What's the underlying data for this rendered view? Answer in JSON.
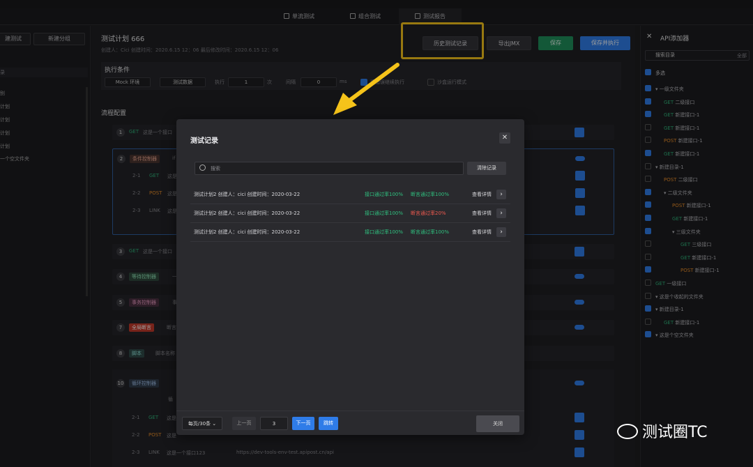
{
  "tabs": [
    {
      "label": "单流测试",
      "active": false
    },
    {
      "label": "组合测试",
      "active": false
    },
    {
      "label": "测试报告",
      "active": true
    }
  ],
  "left": {
    "btn1": "建测试",
    "btn2": "新建分组",
    "search_hint": "录",
    "items": [
      "别",
      "计划",
      "计划",
      "计划",
      "计划",
      "一个空文件夹"
    ]
  },
  "plan": {
    "title": "测试计划 666",
    "meta": "创建人：Cici    创建时间：2020.6.15    12：06        最后修改时间：2020.6.15    12：06",
    "history_button": "历史测试记录",
    "export_button": "导出JMX",
    "save_button": "保存",
    "save_run_button": "保存并执行"
  },
  "exec": {
    "title": "执行条件",
    "env": "Mock 环境",
    "test_data": "测试数据",
    "run_label": "执行",
    "run_value": "1",
    "run_unit": "次",
    "interval_label": "间隔",
    "interval_value": "0",
    "interval_unit": "ms",
    "continue_on_error": "遇错误继续执行",
    "sandbox": "沙盒运行模式"
  },
  "flow": {
    "title": "流程配置",
    "rows": [
      {
        "num": "1",
        "method": "GET",
        "text": "这是一个接口"
      },
      {
        "num": "2",
        "tag": "条件控制器",
        "text": "if"
      },
      {
        "num": "2-1",
        "method": "GET",
        "text": "这是"
      },
      {
        "num": "2-2",
        "method": "POST",
        "text": "这是"
      },
      {
        "num": "2-3",
        "method": "LINK",
        "text": "这是"
      },
      {
        "num": "3",
        "method": "GET",
        "text": "这是一个接口"
      },
      {
        "num": "4",
        "tag": "等待控制器",
        "text": "一"
      },
      {
        "num": "5",
        "tag": "事务控制器",
        "text": "事"
      },
      {
        "num": "7",
        "tag": "全局断言",
        "text": "断言"
      },
      {
        "num": "8",
        "tag": "脚本",
        "text": "脚本名称"
      },
      {
        "num": "10",
        "tag": "循环控制器",
        "text": "循"
      },
      {
        "num": "2-1",
        "method": "GET",
        "text": "这是"
      },
      {
        "num": "2-2",
        "method": "POST",
        "text": "这是"
      },
      {
        "num": "2-3",
        "method": "LINK",
        "text": "这是一个接口123",
        "url": "https://dev-tools-env-test.apipost.cn/api"
      }
    ]
  },
  "api_panel": {
    "title": "API添加器",
    "search_placeholder": "搜索目录",
    "filter": "全部",
    "multi": "多选",
    "tree": [
      {
        "text": "一级文件夹",
        "chk": true,
        "indent": 0
      },
      {
        "method": "GET",
        "text": "二级接口",
        "chk": true,
        "indent": 1
      },
      {
        "method": "GET",
        "text": "新建接口-1",
        "chk": true,
        "indent": 1
      },
      {
        "method": "GET",
        "text": "新建接口-1",
        "chk": false,
        "indent": 1
      },
      {
        "method": "POST",
        "text": "新建接口-1",
        "chk": false,
        "indent": 1
      },
      {
        "method": "GET",
        "text": "新建接口-1",
        "chk": true,
        "indent": 1
      },
      {
        "text": "新建目录-1",
        "chk": false,
        "indent": 0
      },
      {
        "method": "POST",
        "text": "二级接口",
        "chk": false,
        "indent": 1
      },
      {
        "text": "二级文件夹",
        "chk": true,
        "indent": 1
      },
      {
        "method": "POST",
        "text": "新建接口-1",
        "chk": true,
        "indent": 2
      },
      {
        "method": "GET",
        "text": "新建接口-1",
        "chk": true,
        "indent": 2
      },
      {
        "text": "三级文件夹",
        "chk": true,
        "indent": 2
      },
      {
        "method": "GET",
        "text": "三级接口",
        "chk": false,
        "indent": 3
      },
      {
        "method": "GET",
        "text": "新建接口-1",
        "chk": false,
        "indent": 3
      },
      {
        "method": "POST",
        "text": "新建接口-1",
        "chk": true,
        "indent": 3
      },
      {
        "method": "GET",
        "text": "一级接口",
        "chk": false,
        "indent": 0
      },
      {
        "text": "这是个收起的文件夹",
        "chk": false,
        "indent": 0
      },
      {
        "text": "新建目录-1",
        "chk": true,
        "indent": 0
      },
      {
        "method": "GET",
        "text": "新建接口-1",
        "chk": false,
        "indent": 1
      },
      {
        "text": "这是个空文件夹",
        "chk": true,
        "indent": 0
      }
    ]
  },
  "modal": {
    "title": "测试记录",
    "search_placeholder": "搜索",
    "clear": "清除记录",
    "records": [
      {
        "info": "测试计划2   创建人：cici   创建时间：2020-03-22",
        "api": "接口通过率100%",
        "assert": "断言通过率100%",
        "assert_ok": true,
        "detail": "查看详情"
      },
      {
        "info": "测试计划2   创建人：cici   创建时间：2020-03-22",
        "api": "接口通过率100%",
        "assert": "断言通过率20%",
        "assert_ok": false,
        "detail": "查看详情"
      },
      {
        "info": "测试计划2   创建人：cici   创建时间：2020-03-22",
        "api": "接口通过率100%",
        "assert": "断言通过率100%",
        "assert_ok": true,
        "detail": "查看详情"
      }
    ],
    "page_size": "每页/30条",
    "prev": "上一页",
    "page": "3",
    "next": "下一页",
    "jump": "跳转",
    "close": "关闭"
  },
  "watermark": "测试圈TC",
  "colors": {
    "accent": "#2f7ce8",
    "highlight": "#f5c31a",
    "pass": "#2fc07f",
    "fail": "#f05a4f"
  }
}
